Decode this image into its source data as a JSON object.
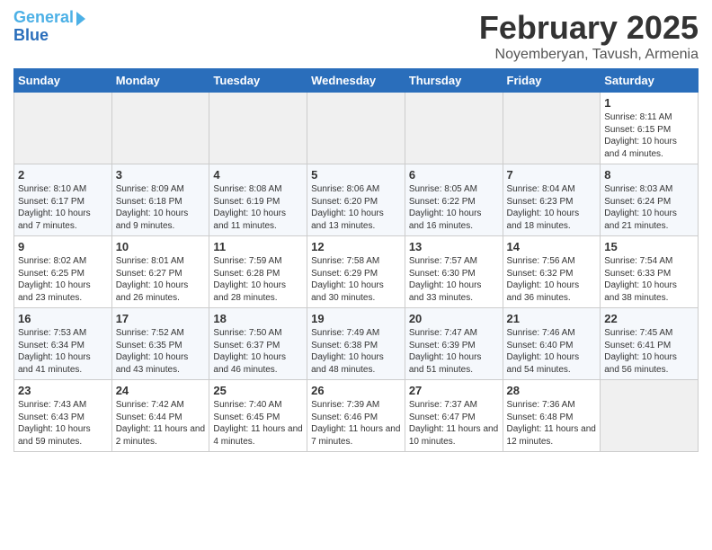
{
  "header": {
    "logo_line1": "General",
    "logo_line2": "Blue",
    "month": "February 2025",
    "location": "Noyemberyan, Tavush, Armenia"
  },
  "days_of_week": [
    "Sunday",
    "Monday",
    "Tuesday",
    "Wednesday",
    "Thursday",
    "Friday",
    "Saturday"
  ],
  "weeks": [
    [
      {
        "num": "",
        "info": ""
      },
      {
        "num": "",
        "info": ""
      },
      {
        "num": "",
        "info": ""
      },
      {
        "num": "",
        "info": ""
      },
      {
        "num": "",
        "info": ""
      },
      {
        "num": "",
        "info": ""
      },
      {
        "num": "1",
        "info": "Sunrise: 8:11 AM\nSunset: 6:15 PM\nDaylight: 10 hours and 4 minutes."
      }
    ],
    [
      {
        "num": "2",
        "info": "Sunrise: 8:10 AM\nSunset: 6:17 PM\nDaylight: 10 hours and 7 minutes."
      },
      {
        "num": "3",
        "info": "Sunrise: 8:09 AM\nSunset: 6:18 PM\nDaylight: 10 hours and 9 minutes."
      },
      {
        "num": "4",
        "info": "Sunrise: 8:08 AM\nSunset: 6:19 PM\nDaylight: 10 hours and 11 minutes."
      },
      {
        "num": "5",
        "info": "Sunrise: 8:06 AM\nSunset: 6:20 PM\nDaylight: 10 hours and 13 minutes."
      },
      {
        "num": "6",
        "info": "Sunrise: 8:05 AM\nSunset: 6:22 PM\nDaylight: 10 hours and 16 minutes."
      },
      {
        "num": "7",
        "info": "Sunrise: 8:04 AM\nSunset: 6:23 PM\nDaylight: 10 hours and 18 minutes."
      },
      {
        "num": "8",
        "info": "Sunrise: 8:03 AM\nSunset: 6:24 PM\nDaylight: 10 hours and 21 minutes."
      }
    ],
    [
      {
        "num": "9",
        "info": "Sunrise: 8:02 AM\nSunset: 6:25 PM\nDaylight: 10 hours and 23 minutes."
      },
      {
        "num": "10",
        "info": "Sunrise: 8:01 AM\nSunset: 6:27 PM\nDaylight: 10 hours and 26 minutes."
      },
      {
        "num": "11",
        "info": "Sunrise: 7:59 AM\nSunset: 6:28 PM\nDaylight: 10 hours and 28 minutes."
      },
      {
        "num": "12",
        "info": "Sunrise: 7:58 AM\nSunset: 6:29 PM\nDaylight: 10 hours and 30 minutes."
      },
      {
        "num": "13",
        "info": "Sunrise: 7:57 AM\nSunset: 6:30 PM\nDaylight: 10 hours and 33 minutes."
      },
      {
        "num": "14",
        "info": "Sunrise: 7:56 AM\nSunset: 6:32 PM\nDaylight: 10 hours and 36 minutes."
      },
      {
        "num": "15",
        "info": "Sunrise: 7:54 AM\nSunset: 6:33 PM\nDaylight: 10 hours and 38 minutes."
      }
    ],
    [
      {
        "num": "16",
        "info": "Sunrise: 7:53 AM\nSunset: 6:34 PM\nDaylight: 10 hours and 41 minutes."
      },
      {
        "num": "17",
        "info": "Sunrise: 7:52 AM\nSunset: 6:35 PM\nDaylight: 10 hours and 43 minutes."
      },
      {
        "num": "18",
        "info": "Sunrise: 7:50 AM\nSunset: 6:37 PM\nDaylight: 10 hours and 46 minutes."
      },
      {
        "num": "19",
        "info": "Sunrise: 7:49 AM\nSunset: 6:38 PM\nDaylight: 10 hours and 48 minutes."
      },
      {
        "num": "20",
        "info": "Sunrise: 7:47 AM\nSunset: 6:39 PM\nDaylight: 10 hours and 51 minutes."
      },
      {
        "num": "21",
        "info": "Sunrise: 7:46 AM\nSunset: 6:40 PM\nDaylight: 10 hours and 54 minutes."
      },
      {
        "num": "22",
        "info": "Sunrise: 7:45 AM\nSunset: 6:41 PM\nDaylight: 10 hours and 56 minutes."
      }
    ],
    [
      {
        "num": "23",
        "info": "Sunrise: 7:43 AM\nSunset: 6:43 PM\nDaylight: 10 hours and 59 minutes."
      },
      {
        "num": "24",
        "info": "Sunrise: 7:42 AM\nSunset: 6:44 PM\nDaylight: 11 hours and 2 minutes."
      },
      {
        "num": "25",
        "info": "Sunrise: 7:40 AM\nSunset: 6:45 PM\nDaylight: 11 hours and 4 minutes."
      },
      {
        "num": "26",
        "info": "Sunrise: 7:39 AM\nSunset: 6:46 PM\nDaylight: 11 hours and 7 minutes."
      },
      {
        "num": "27",
        "info": "Sunrise: 7:37 AM\nSunset: 6:47 PM\nDaylight: 11 hours and 10 minutes."
      },
      {
        "num": "28",
        "info": "Sunrise: 7:36 AM\nSunset: 6:48 PM\nDaylight: 11 hours and 12 minutes."
      },
      {
        "num": "",
        "info": ""
      }
    ]
  ]
}
